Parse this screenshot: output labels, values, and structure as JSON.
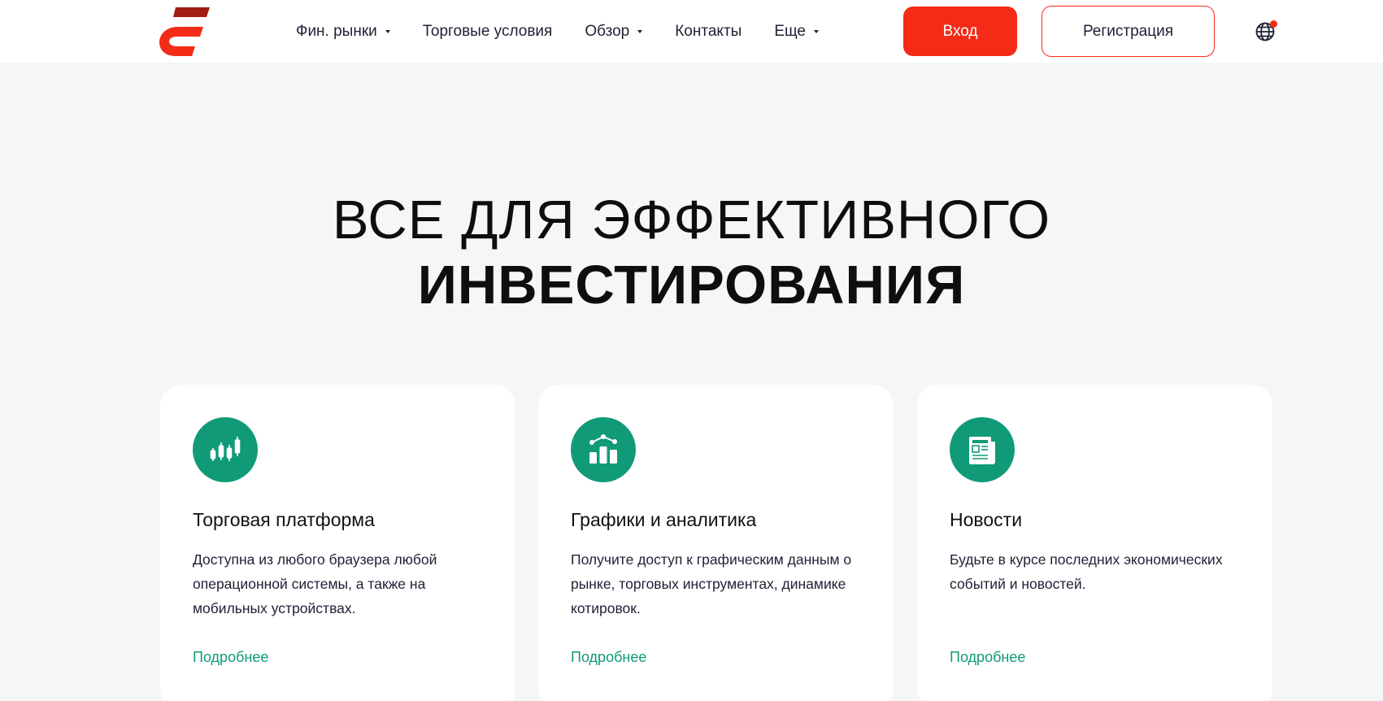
{
  "header": {
    "nav": [
      {
        "label": "Фин. рынки",
        "has_dropdown": true
      },
      {
        "label": "Торговые условия",
        "has_dropdown": false
      },
      {
        "label": "Обзор",
        "has_dropdown": true
      },
      {
        "label": "Контакты",
        "has_dropdown": false
      },
      {
        "label": "Еще",
        "has_dropdown": true
      }
    ],
    "login_label": "Вход",
    "register_label": "Регистрация",
    "language_icon": "globe-icon"
  },
  "hero": {
    "line1": "ВСЕ ДЛЯ ЭФФЕКТИВНОГО",
    "line2": "ИНВЕСТИРОВАНИЯ"
  },
  "cards": [
    {
      "icon": "candlestick-chart-icon",
      "title": "Торговая платформа",
      "description": "Доступна из любого браузера любой операционной системы, а также на мобильных устройствах.",
      "link": "Подробнее"
    },
    {
      "icon": "bar-chart-icon",
      "title": "Графики и аналитика",
      "description": "Получите доступ к графическим данным о рынке, торговых инструментах, динамике котировок.",
      "link": "Подробнее"
    },
    {
      "icon": "newspaper-icon",
      "title": "Новости",
      "description": "Будьте в курсе последних экономических событий и новостей.",
      "link": "Подробнее"
    }
  ],
  "colors": {
    "accent_red": "#f42b17",
    "accent_green": "#119a78",
    "background": "#f5f6f8"
  }
}
